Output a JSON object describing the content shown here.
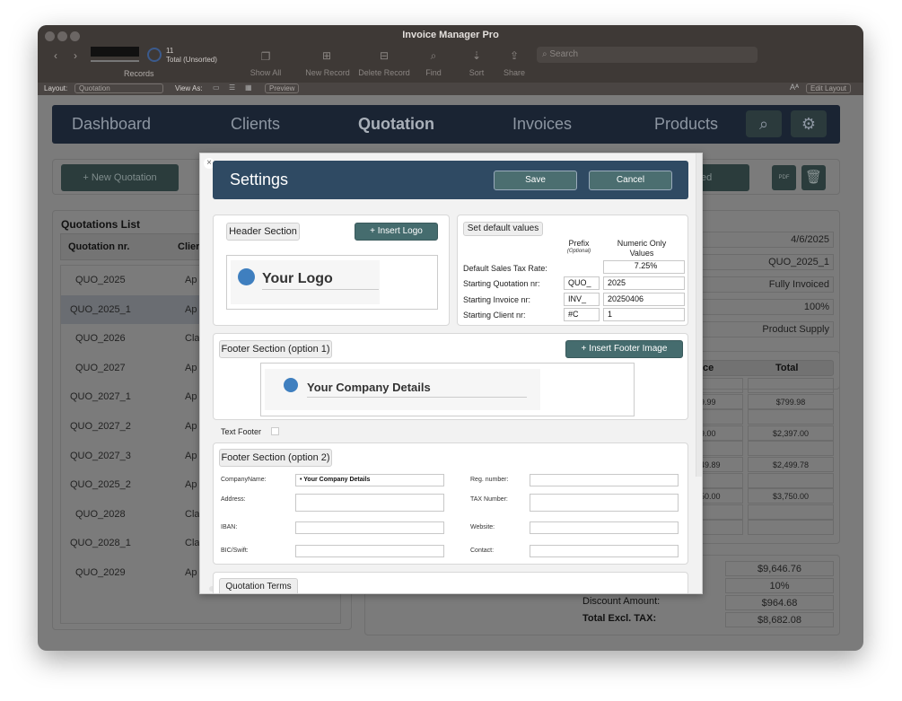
{
  "window": {
    "title": "Invoice Manager Pro"
  },
  "toolbar": {
    "record_count": "11",
    "record_status": "Total (Unsorted)",
    "records_label": "Records",
    "show_all": "Show All",
    "new_record": "New Record",
    "delete_record": "Delete Record",
    "find": "Find",
    "sort": "Sort",
    "share": "Share",
    "search_placeholder": "Search"
  },
  "layout_bar": {
    "layout_label": "Layout:",
    "layout_value": "Quotation",
    "view_as": "View As:",
    "preview": "Preview",
    "edit_layout": "Edit Layout"
  },
  "nav": {
    "items": [
      "Dashboard",
      "Clients",
      "Quotation",
      "Invoices",
      "Products"
    ],
    "active": "Quotation"
  },
  "actions": {
    "new_quotation": "+ New Quotation",
    "partial_button": "ed",
    "pdf_icon_label": "PDF"
  },
  "list": {
    "title": "Quotations List",
    "columns": [
      "Quotation nr.",
      "Clier"
    ],
    "rows": [
      {
        "nr": "QUO_2025",
        "client": "Ap"
      },
      {
        "nr": "QUO_2025_1",
        "client": "Ap",
        "selected": true
      },
      {
        "nr": "QUO_2026",
        "client": "Cla"
      },
      {
        "nr": "QUO_2027",
        "client": "Ap"
      },
      {
        "nr": "QUO_2027_1",
        "client": "Ap"
      },
      {
        "nr": "QUO_2027_2",
        "client": "Ap"
      },
      {
        "nr": "QUO_2027_3",
        "client": "Ap"
      },
      {
        "nr": "QUO_2025_2",
        "client": "Ap"
      },
      {
        "nr": "QUO_2028",
        "client": "Cla"
      },
      {
        "nr": "QUO_2028_1",
        "client": "Cla"
      },
      {
        "nr": "QUO_2029",
        "client": "Ap"
      }
    ]
  },
  "details": {
    "date": "4/6/2025",
    "quotation_nr": "QUO_2025_1",
    "status": "Fully Invoiced",
    "percent": "100%",
    "type": "Product Supply"
  },
  "items": {
    "columns": [
      "ice",
      "Total"
    ],
    "rows": [
      [
        "",
        ""
      ],
      [
        "9.99",
        "$799.98"
      ],
      [
        "",
        ""
      ],
      [
        "9.00",
        "$2,397.00"
      ],
      [
        "",
        ""
      ],
      [
        "49.89",
        "$2,499.78"
      ],
      [
        "",
        ""
      ],
      [
        "50.00",
        "$3,750.00"
      ],
      [
        "",
        ""
      ],
      [
        "",
        ""
      ]
    ]
  },
  "totals": {
    "subtotal": "$9,646.76",
    "discount_pct": "10%",
    "discount_label": "Discount Amount:",
    "discount_amount": "$964.68",
    "total_label": "Total Excl. TAX:",
    "total": "$8,682.08"
  },
  "modal": {
    "title": "Settings",
    "save": "Save",
    "cancel": "Cancel",
    "header_section": "Header Section",
    "insert_logo": "+ Insert Logo",
    "logo_text": "Your Logo",
    "defaults": {
      "title": "Set default values",
      "prefix_header": "Prefix",
      "prefix_sub": "(Optional)",
      "numeric_header": "Numeric Only Values",
      "tax_label": "Default Sales Tax Rate:",
      "tax_value": "7.25%",
      "rows": [
        {
          "label": "Starting Quotation nr:",
          "prefix": "QUO_",
          "value": "2025"
        },
        {
          "label": "Starting Invoice nr:",
          "prefix": "INV_",
          "value": "20250406"
        },
        {
          "label": "Starting Client nr:",
          "prefix": "#C",
          "value": "1"
        }
      ]
    },
    "footer1": {
      "title": "Footer Section (option 1)",
      "insert": "+ Insert Footer Image",
      "company_text": "Your Company Details"
    },
    "text_footer": {
      "label": "Text Footer",
      "checked": false
    },
    "footer2": {
      "title": "Footer Section (option 2)",
      "left": [
        {
          "label": "CompanyName:",
          "value": "• Your Company Details"
        },
        {
          "label": "Address:",
          "value": ""
        },
        {
          "label": "IBAN:",
          "value": ""
        },
        {
          "label": "BIC/Swift:",
          "value": ""
        }
      ],
      "right": [
        {
          "label": "Reg. number:",
          "value": ""
        },
        {
          "label": "TAX Number:",
          "value": ""
        },
        {
          "label": "Website:",
          "value": ""
        },
        {
          "label": "Contact:",
          "value": ""
        }
      ]
    },
    "terms_title": "Quotation Terms"
  },
  "colors": {
    "nav_bg": "#1a2433",
    "modal_header": "#2f4a63",
    "teal_button": "#456c6e",
    "logo_dot": "#3f7fbf"
  }
}
